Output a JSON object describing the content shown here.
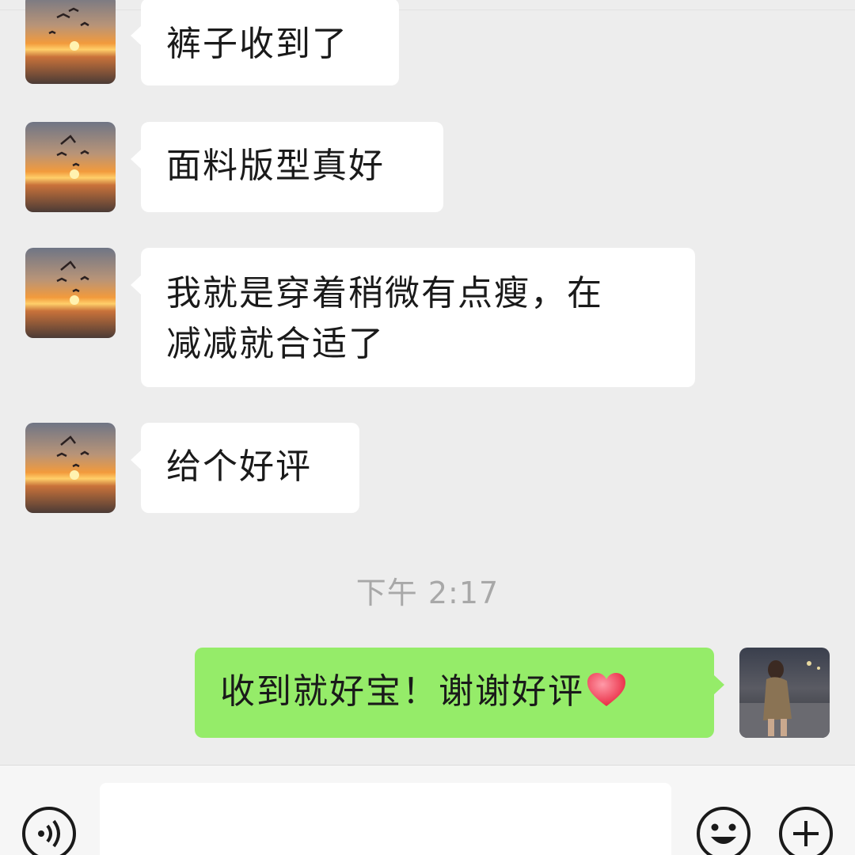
{
  "chat": {
    "messages": [
      {
        "sender": "other",
        "text": "裤子收到了"
      },
      {
        "sender": "other",
        "text": "面料版型真好"
      },
      {
        "sender": "other",
        "text_line1": "我就是穿着稍微有点瘦，在",
        "text_line2": "减减就合适了"
      },
      {
        "sender": "other",
        "text": "给个好评"
      },
      {
        "sender": "self",
        "text": "收到就好宝！谢谢好评",
        "emoji": "red-heart"
      }
    ],
    "timestamp": "下午 2:17"
  },
  "input_bar": {
    "voice_icon": "voice-icon",
    "emoji_icon": "emoji-smile-icon",
    "plus_icon": "plus-icon"
  },
  "colors": {
    "background": "#ededed",
    "incoming_bubble": "#ffffff",
    "outgoing_bubble": "#95ec69",
    "timestamp_text": "#a8a8a8"
  }
}
